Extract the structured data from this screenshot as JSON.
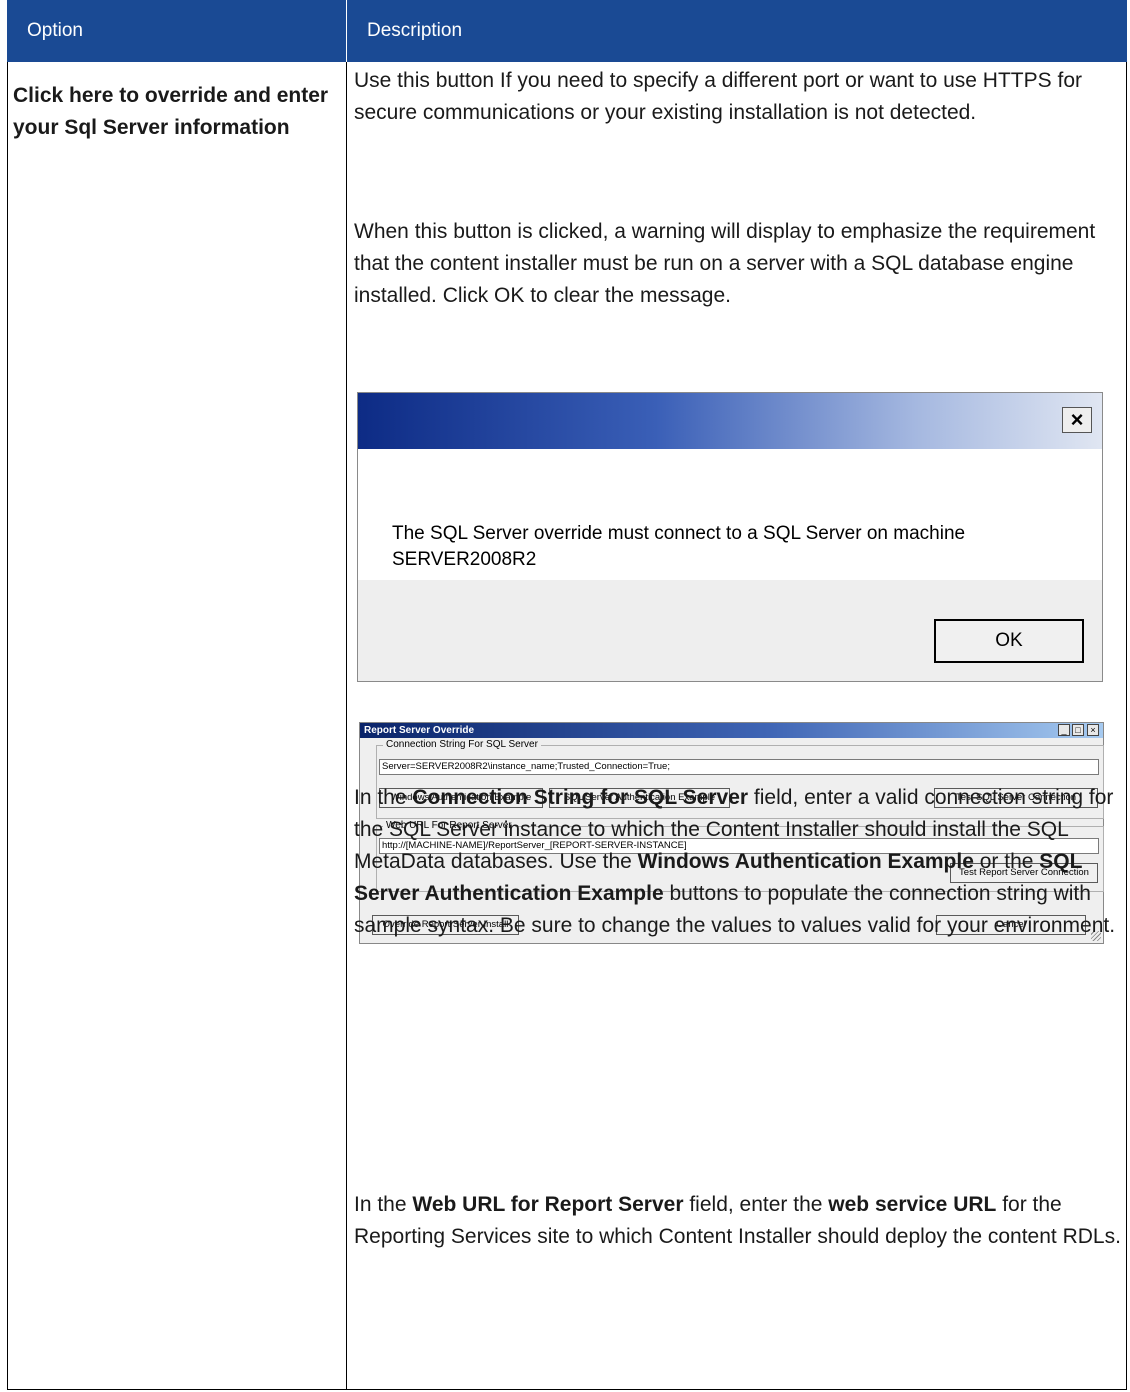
{
  "header": {
    "option_label": "Option",
    "description_label": "Description"
  },
  "colors": {
    "header_bg": "#1a4a94",
    "dialog_title_gradient_start": "#0d2b85"
  },
  "option": {
    "title": "Click here to override and enter your Sql Server information"
  },
  "description": {
    "p1": "Use this button If you need to specify a different port or want to use HTTPS for secure communications or your existing installation is not detected.",
    "p2": "When this button is clicked, a warning will display to emphasize the requirement that the content installer must be run on a server with a SQL database engine installed. Click OK to clear the message.",
    "p3": {
      "t1": "In the ",
      "b1": "Connection String for SQL Server",
      "t2": " field, enter a valid connection string for the SQL Server instance to which the Content Installer should install the SQL MetaData databases. Use the ",
      "b2": "Windows Authentication Example",
      "t3": " or the ",
      "b3": "SQL Server Authentication Example",
      "t4": " buttons to populate the connection string with sample syntax. Be sure to change the values to values valid for your environment."
    },
    "p4": {
      "t1": "In the ",
      "b1": "Web URL for Report Server",
      "t2": " field, enter the ",
      "b2": "web service URL",
      "t3": " for the Reporting Services site to which Content Installer should deploy the content RDLs."
    }
  },
  "warning_dialog": {
    "close_glyph": "×",
    "close_icon": "close-icon",
    "message": "The SQL Server override must connect to a SQL Server on machine SERVER2008R2",
    "ok_label": "OK"
  },
  "override_window": {
    "title": "Report Server Override",
    "min_glyph": "_",
    "max_glyph": "□",
    "close_glyph": "×",
    "connection_group_label": "Connection String For SQL Server",
    "connection_string": "Server=SERVER2008R2\\instance_name;Trusted_Connection=True;",
    "windows_auth_button": "Windows Authentication Example",
    "sql_auth_button": "SQL Server Authentication Example",
    "test_sql_button": "Test SQL Server Connection",
    "web_url_group_label": "Web URL For Report Server",
    "web_url": "http://[MACHINE-NAME]/ReportServer_[REPORT-SERVER-INSTANCE]",
    "test_report_button": "Test Report Server Connection",
    "override_button": "Override Report Server Install",
    "cancel_button": "Cancel"
  }
}
